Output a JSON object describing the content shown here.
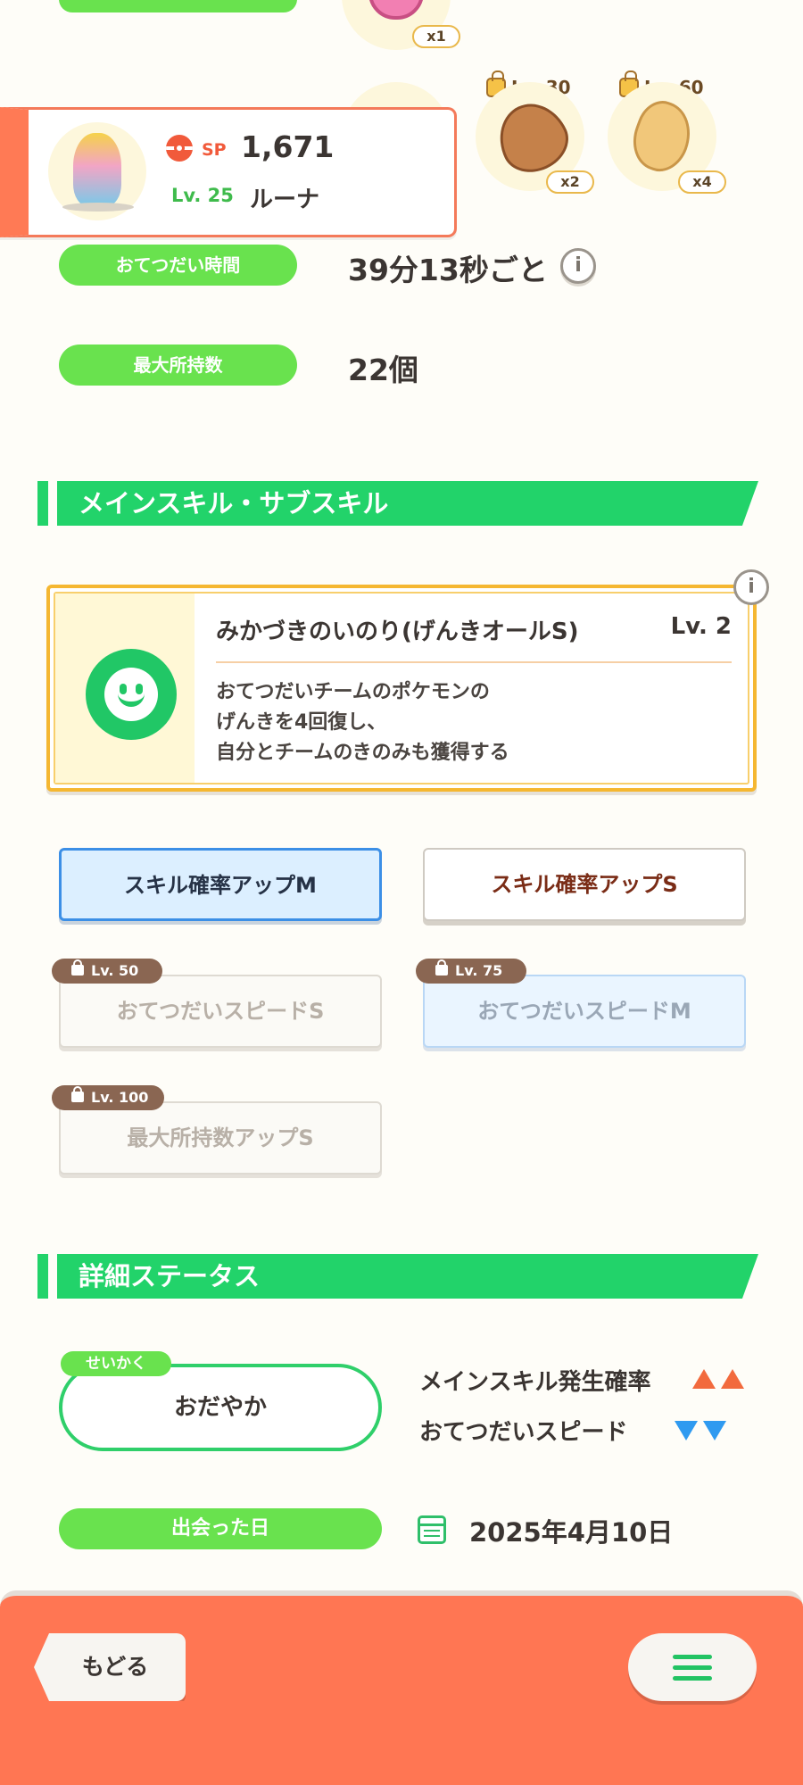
{
  "ingredients": [
    {
      "qty": "x1"
    },
    {
      "lock_label": "Lv. 30",
      "qty": "x2"
    },
    {
      "lock_label": "Lv. 60",
      "qty": "x4"
    }
  ],
  "pokemon": {
    "sp_label": "SP",
    "sp_value": "1,671",
    "level": "Lv. 25",
    "name": "ルーナ"
  },
  "info": {
    "help_time_label": "おてつだい時間",
    "help_time_value": "39分13秒ごと",
    "max_carry_label": "最大所持数",
    "max_carry_value": "22個"
  },
  "skills_section": {
    "title": "メインスキル・サブスキル",
    "main_skill": {
      "name": "みかづきのいのり(げんきオールS)",
      "level": "Lv. 2",
      "desc_lines": [
        "おてつだいチームのポケモンの",
        "げんきを4回復し、",
        "自分とチームのきのみも獲得する"
      ]
    },
    "sub_skills": [
      {
        "label": "スキル確率アップM"
      },
      {
        "label": "スキル確率アップS"
      },
      {
        "label": "おてつだいスピードS",
        "lock": "Lv. 50"
      },
      {
        "label": "おてつだいスピードM",
        "lock": "Lv. 75"
      },
      {
        "label": "最大所持数アップS",
        "lock": "Lv. 100"
      }
    ]
  },
  "detail_section": {
    "title": "詳細ステータス",
    "nature_tag": "せいかく",
    "nature": "おだやか",
    "up_stat": "メインスキル発生確率",
    "down_stat": "おてつだいスピード",
    "met_label": "出会った日",
    "met_date": "2025年4月10日"
  },
  "footer": {
    "back_label": "もどる"
  },
  "colors": {
    "green_pill": "#69e24e",
    "section_green": "#22d36a",
    "bottom_bar": "#ff7653",
    "up_arrow": "#f26a3d",
    "down_arrow": "#2f9af0"
  }
}
